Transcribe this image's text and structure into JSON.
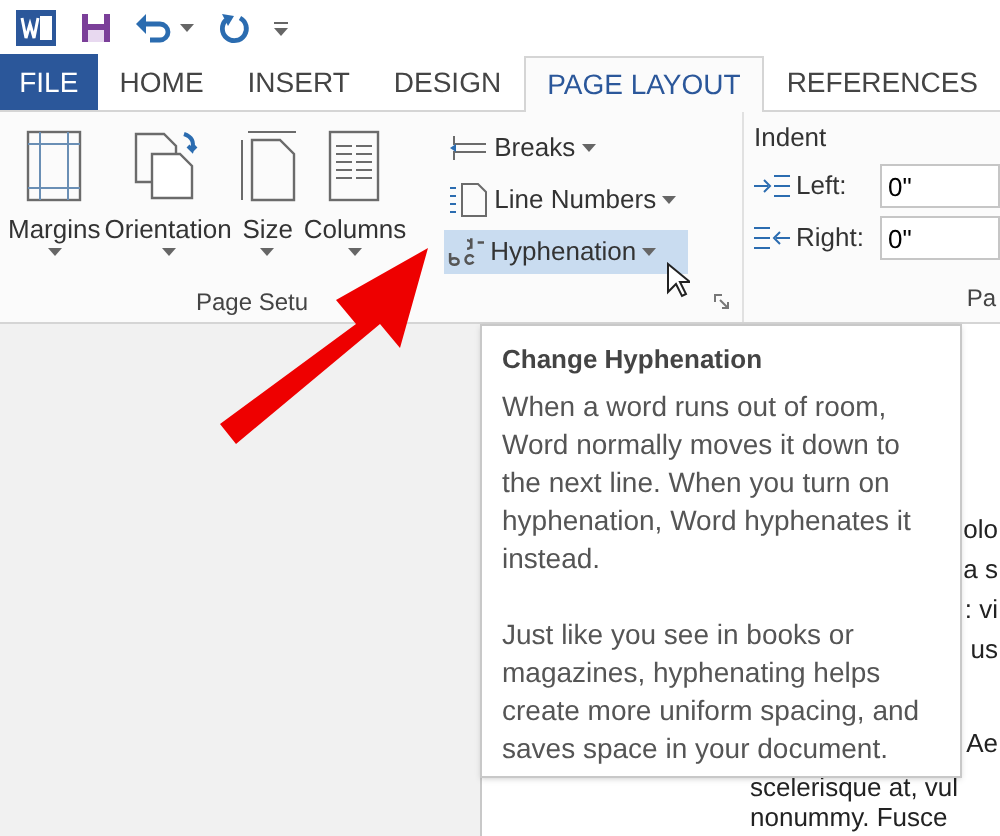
{
  "tabs": [
    {
      "label": "FILE",
      "kind": "file",
      "selected": false
    },
    {
      "label": "HOME",
      "kind": "tab",
      "selected": false
    },
    {
      "label": "INSERT",
      "kind": "tab",
      "selected": false
    },
    {
      "label": "DESIGN",
      "kind": "tab",
      "selected": false
    },
    {
      "label": "PAGE LAYOUT",
      "kind": "tab",
      "selected": true
    },
    {
      "label": "REFERENCES",
      "kind": "tab",
      "selected": false
    }
  ],
  "page_setup": {
    "label": "Page Setu",
    "large_buttons": [
      {
        "label": "Margins",
        "kind": "margins"
      },
      {
        "label": "Orientation",
        "kind": "orientation"
      },
      {
        "label": "Size",
        "kind": "size"
      },
      {
        "label": "Columns",
        "kind": "columns"
      }
    ],
    "small_buttons": [
      {
        "label": "Breaks",
        "kind": "breaks",
        "highlighted": false
      },
      {
        "label": "Line Numbers",
        "kind": "line_numbers",
        "highlighted": false
      },
      {
        "label": "Hyphenation",
        "kind": "hyphenation",
        "highlighted": true
      }
    ]
  },
  "indent": {
    "title": "Indent",
    "fields": [
      {
        "label": "Left:",
        "kind": "left",
        "value": "0\""
      },
      {
        "label": "Right:",
        "kind": "right",
        "value": "0\""
      }
    ]
  },
  "paragraph_label": "Pa",
  "tooltip": {
    "title": "Change Hyphenation",
    "paragraphs": [
      "When a word runs out of room, Word normally moves it down to the next line. When you turn on hyphenation, Word hyphenates it instead.",
      "Just like you see in books or magazines, hyphenating helps create more uniform spacing, and saves space in your document."
    ]
  },
  "document": {
    "lines": [
      {
        "text": "olo",
        "kind": "clipped"
      },
      {
        "text": "a s",
        "kind": "clipped"
      },
      {
        "text": ": vi",
        "kind": "clipped"
      },
      {
        "text": "us",
        "kind": "clipped"
      },
      {
        "text": "Ae",
        "kind": "clipped"
      },
      {
        "text": "scelerisque at, vul",
        "kind": "full"
      },
      {
        "text": "nonummy. Fusce",
        "kind": "full"
      }
    ]
  }
}
